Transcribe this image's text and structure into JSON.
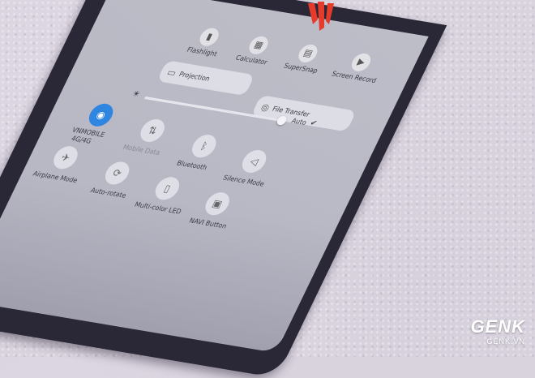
{
  "quick_settings": {
    "tiles_top": [
      "Flashlight",
      "Calculator",
      "SuperSnap",
      "Screen Record"
    ],
    "wide_buttons": [
      "Projection",
      "File Transfer"
    ],
    "brightness_label": "Auto",
    "network": {
      "line1": "VNMOBILE",
      "line2": "4G/4G"
    },
    "toggles": [
      "Airplane Mode",
      "Auto-rotate",
      "Multi-color LED",
      "NAVI Button"
    ],
    "toggles_upper": [
      "Mobile Data",
      "Bluetooth",
      "Silence Mode"
    ]
  },
  "watermark": {
    "brand": "GENK",
    "site": "GENK.VN"
  },
  "icons": [
    "flashlight-icon",
    "calculator-icon",
    "supersnap-icon",
    "screen-record-icon",
    "projection-icon",
    "file-transfer-icon",
    "wifi-icon",
    "mobile-data-icon",
    "bluetooth-icon",
    "silence-icon",
    "airplane-icon",
    "auto-rotate-icon",
    "led-icon",
    "navi-icon",
    "brightness-icon"
  ],
  "colors": {
    "accent": "#2f86e0",
    "logo": "#e63a2a",
    "frame": "#2a2836"
  }
}
